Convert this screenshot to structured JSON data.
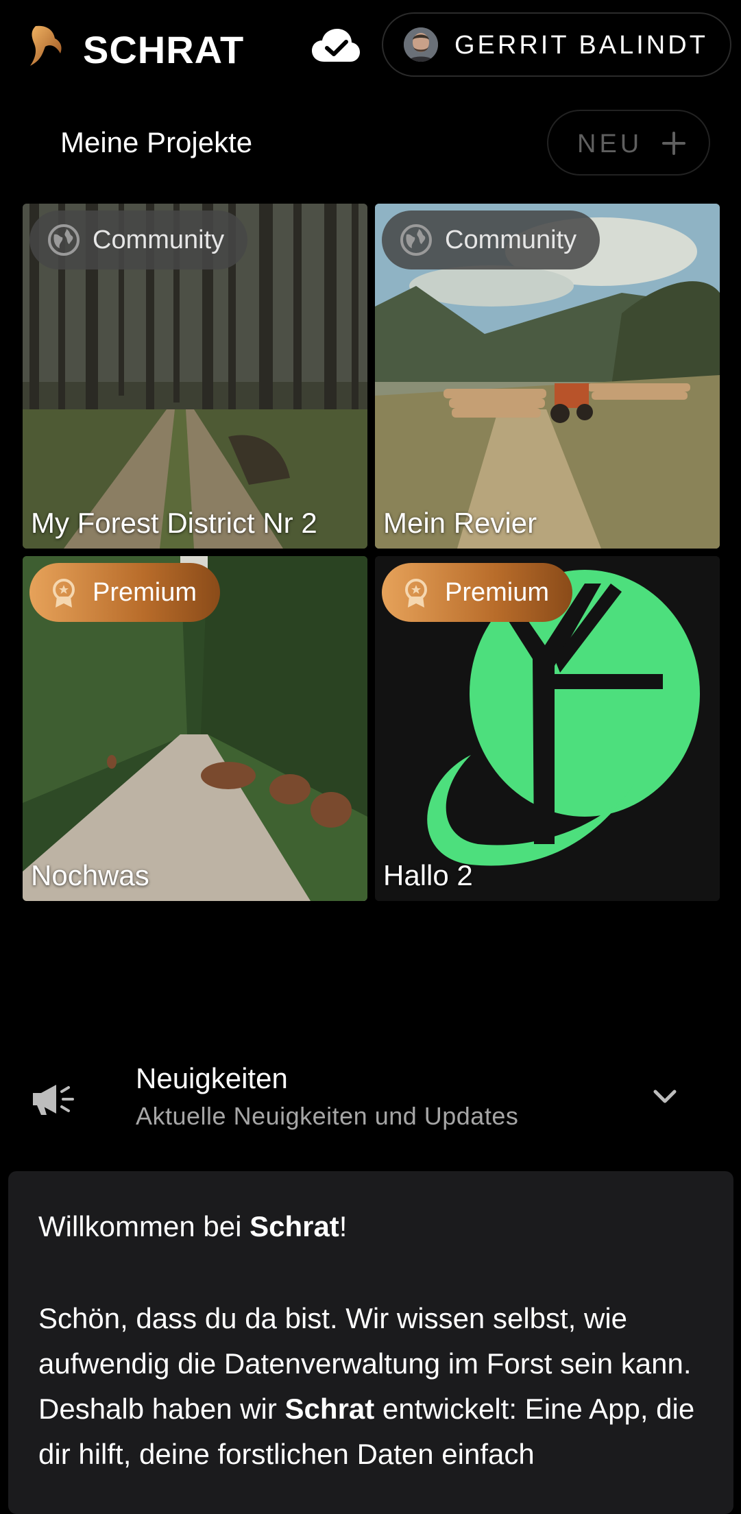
{
  "header": {
    "brand": "SCHRAT",
    "user_name": "GERRIT BALINDT",
    "icons": [
      "schrat-logo-icon",
      "cloud-check-icon",
      "avatar"
    ]
  },
  "projects": {
    "title": "Meine Projekte",
    "new_label": "NEU",
    "cards": [
      {
        "title": "My Forest District Nr 2",
        "badge": "Community",
        "badge_icon": "globe-icon"
      },
      {
        "title": "Mein Revier",
        "badge": "Community",
        "badge_icon": "globe-icon"
      },
      {
        "title": "Nochwas",
        "badge": "Premium",
        "badge_icon": "award-icon"
      },
      {
        "title": "Hallo 2",
        "badge": "Premium",
        "badge_icon": "award-icon"
      }
    ]
  },
  "news": {
    "title": "Neuigkeiten",
    "subtitle": "Aktuelle Neuigkeiten und Updates",
    "icon": "megaphone-icon"
  },
  "welcome": {
    "greeting_prefix": "Willkommen bei ",
    "brand": "Schrat",
    "greeting_suffix": "!",
    "body_1": "Schön, dass du da bist. Wir wissen selbst, wie aufwendig die Datenverwaltung im Forst sein kann. Deshalb haben wir ",
    "body_brand": "Schrat",
    "body_2": " entwickelt: Eine App, die dir hilft, deine forstlichen Daten einfach"
  },
  "colors": {
    "background": "#000000",
    "premium_start": "#e6a25a",
    "premium_end": "#8a4b19",
    "community_badge": "#464646",
    "logo_green": "#4ddf7d",
    "muted_text": "#a6a6a6"
  }
}
